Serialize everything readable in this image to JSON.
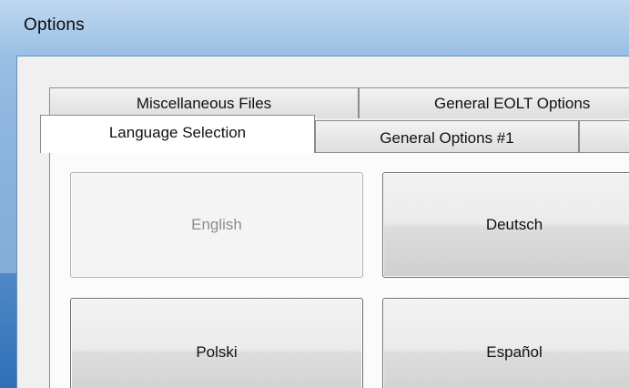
{
  "window": {
    "title": "Options"
  },
  "tabs": {
    "row_back": [
      {
        "label": "Miscellaneous Files"
      },
      {
        "label": "General EOLT Options"
      }
    ],
    "row_front": [
      {
        "label": "Language Selection",
        "active": true
      },
      {
        "label": "General Options #1",
        "active": false
      },
      {
        "label": "",
        "active": false
      }
    ]
  },
  "languages": [
    {
      "label": "English",
      "enabled": false
    },
    {
      "label": "Deutsch",
      "enabled": true
    },
    {
      "label": "Polski",
      "enabled": true
    },
    {
      "label": "Español",
      "enabled": true
    }
  ],
  "colors": {
    "titlebar": "#9cc1e6",
    "dialog_bg": "#f0f0f0",
    "panel_bg": "#fbfbfb",
    "disabled_text": "#8d8d8d"
  }
}
